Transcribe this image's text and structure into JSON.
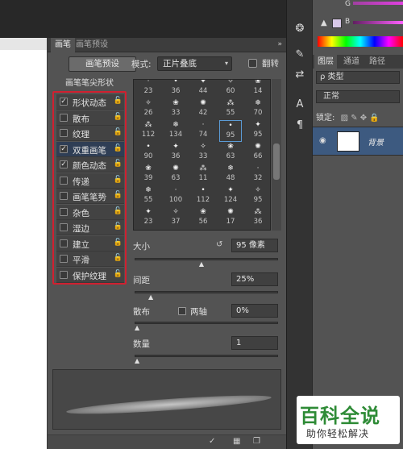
{
  "panel": {
    "tabs": [
      "画笔",
      "画笔预设"
    ],
    "menu_icon": "»",
    "preset_button": "画笔预设",
    "mode_label": "模式:",
    "mode_value": "正片叠底",
    "flip_label": "翻转",
    "tip_header": "画笔笔尖形状"
  },
  "options": [
    {
      "label": "形状动态",
      "checked": true
    },
    {
      "label": "散布",
      "checked": false
    },
    {
      "label": "纹理",
      "checked": false
    },
    {
      "label": "双重画笔",
      "checked": true
    },
    {
      "label": "颜色动态",
      "checked": true
    },
    {
      "label": "传递",
      "checked": false
    },
    {
      "label": "画笔笔势",
      "checked": false
    },
    {
      "label": "杂色",
      "checked": false
    },
    {
      "label": "湿边",
      "checked": false
    },
    {
      "label": "建立",
      "checked": false
    },
    {
      "label": "平滑",
      "checked": false
    },
    {
      "label": "保护纹理",
      "checked": false
    }
  ],
  "brush_sizes": [
    [
      "23",
      "36",
      "44",
      "60",
      "14"
    ],
    [
      "26",
      "33",
      "42",
      "55",
      "70"
    ],
    [
      "112",
      "134",
      "74",
      "95",
      "95"
    ],
    [
      "90",
      "36",
      "33",
      "63",
      "66"
    ],
    [
      "39",
      "63",
      "11",
      "48",
      "32"
    ],
    [
      "55",
      "100",
      "112",
      "124",
      "95"
    ],
    [
      "23",
      "37",
      "56",
      "17",
      "36"
    ]
  ],
  "selected_brush": {
    "row": 2,
    "col": 3
  },
  "controls": {
    "size_label": "大小",
    "size_value": "95 像素",
    "size_level": 0.47,
    "spacing_label": "间距",
    "spacing_value": "25%",
    "spacing_level": 0.1,
    "scatter_label": "散布",
    "both_axes_label": "两轴",
    "scatter_value": "0%",
    "scatter_level": 0.0,
    "count_label": "数量",
    "count_value": "1",
    "count_level": 0.0
  },
  "layers": {
    "tabs": [
      "图层",
      "通道",
      "路径"
    ],
    "kind_filter": "ρ 类型",
    "blend_mode": "正常",
    "lock_label": "锁定:",
    "layer_name": "背景"
  },
  "color": {
    "g_label": "G",
    "b_label": "B"
  },
  "watermark": {
    "logo": "百科全说",
    "sub": "助你轻松解决"
  }
}
